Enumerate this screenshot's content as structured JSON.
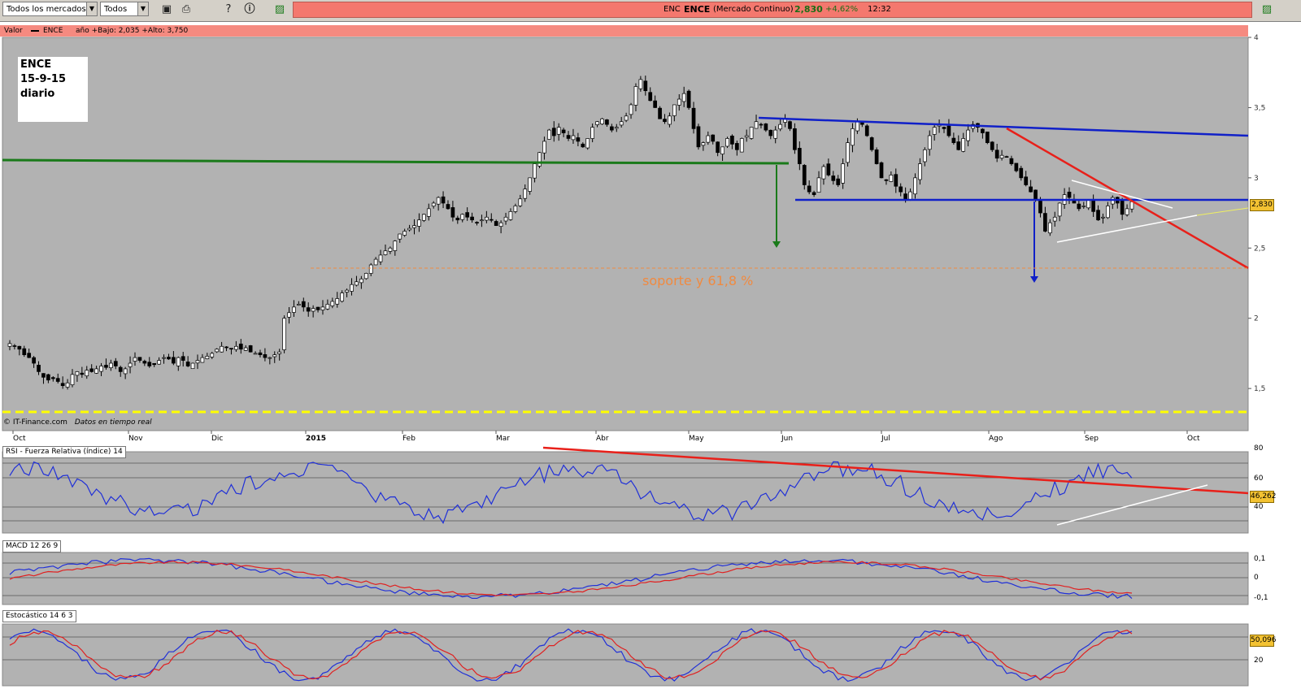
{
  "toolbar": {
    "market_select": "Todos los mercados",
    "type_select": "Todos",
    "ticker_code": "ENC",
    "ticker_name": "ENCE",
    "market": "(Mercado Continuo)",
    "price": "2,830",
    "change": "+4,62%",
    "time": "12:32"
  },
  "price_panel": {
    "header_label": "Valor",
    "header_symbol": "ENCE",
    "header_range": "año +Bajo: 2,035 +Alto: 3,750",
    "note_lines": [
      "ENCE",
      "15-9-15",
      "diario"
    ],
    "annotation": "soporte  y  61,8 %",
    "last_price_tag": "2,830",
    "source_label": "© IT-Finance.com",
    "source_note": "Datos en tiempo real"
  },
  "indicators": {
    "rsi": {
      "label": "RSI - Fuerza Relativa (índice) 14",
      "last_tag": "46,262",
      "ticks": [
        "80",
        "60",
        "40"
      ]
    },
    "macd": {
      "label": "MACD 12 26 9",
      "ticks": [
        "0,1",
        "0",
        "-0,1"
      ]
    },
    "stoch": {
      "label": "Estocástico 14 6 3",
      "last_tag": "50,096",
      "ticks": [
        "20"
      ]
    }
  },
  "chart_data": {
    "type": "candlestick",
    "title": "ENCE",
    "x_labels": [
      "Oct",
      "Nov",
      "Dic",
      "2015",
      "Feb",
      "Mar",
      "Abr",
      "May",
      "Jun",
      "Jul",
      "Ago",
      "Sep",
      "Oct"
    ],
    "y_ticks": [
      "4",
      "3,5",
      "3",
      "2,5",
      "2",
      "1,5"
    ],
    "ylim": [
      1.2,
      4.0
    ],
    "closes": [
      1.82,
      1.8,
      1.78,
      1.74,
      1.72,
      1.68,
      1.62,
      1.58,
      1.56,
      1.57,
      1.55,
      1.52,
      1.54,
      1.6,
      1.62,
      1.6,
      1.63,
      1.62,
      1.64,
      1.66,
      1.65,
      1.68,
      1.66,
      1.62,
      1.64,
      1.68,
      1.72,
      1.7,
      1.68,
      1.66,
      1.67,
      1.7,
      1.72,
      1.71,
      1.68,
      1.72,
      1.7,
      1.66,
      1.68,
      1.7,
      1.72,
      1.73,
      1.75,
      1.78,
      1.8,
      1.79,
      1.78,
      1.8,
      1.78,
      1.79,
      1.76,
      1.75,
      1.74,
      1.72,
      1.72,
      1.74,
      1.76,
      2.0,
      2.04,
      2.08,
      2.1,
      2.08,
      2.05,
      2.07,
      2.06,
      2.08,
      2.1,
      2.12,
      2.14,
      2.18,
      2.2,
      2.24,
      2.26,
      2.28,
      2.32,
      2.38,
      2.42,
      2.45,
      2.48,
      2.5,
      2.55,
      2.6,
      2.62,
      2.64,
      2.66,
      2.7,
      2.74,
      2.78,
      2.82,
      2.86,
      2.82,
      2.78,
      2.72,
      2.7,
      2.74,
      2.72,
      2.7,
      2.68,
      2.7,
      2.72,
      2.7,
      2.66,
      2.68,
      2.72,
      2.76,
      2.8,
      2.85,
      2.92,
      3.0,
      3.1,
      3.18,
      3.26,
      3.34,
      3.3,
      3.36,
      3.32,
      3.28,
      3.3,
      3.26,
      3.22,
      3.28,
      3.36,
      3.4,
      3.42,
      3.38,
      3.34,
      3.36,
      3.4,
      3.44,
      3.52,
      3.65,
      3.7,
      3.62,
      3.55,
      3.5,
      3.42,
      3.4,
      3.44,
      3.52,
      3.56,
      3.6,
      3.5,
      3.35,
      3.22,
      3.25,
      3.3,
      3.26,
      3.18,
      3.22,
      3.28,
      3.24,
      3.2,
      3.28,
      3.3,
      3.36,
      3.4,
      3.38,
      3.34,
      3.3,
      3.34,
      3.38,
      3.42,
      3.35,
      3.2,
      3.1,
      2.95,
      2.9,
      2.88,
      3.0,
      3.08,
      3.02,
      2.98,
      2.95,
      3.1,
      3.25,
      3.35,
      3.4,
      3.38,
      3.3,
      3.2,
      3.1,
      3.0,
      2.98,
      3.02,
      2.94,
      2.9,
      2.85,
      2.9,
      3.0,
      3.1,
      3.2,
      3.3,
      3.36,
      3.38,
      3.35,
      3.3,
      3.25,
      3.2,
      3.28,
      3.34,
      3.38,
      3.36,
      3.32,
      3.25,
      3.2,
      3.14,
      3.16,
      3.15,
      3.1,
      3.05,
      3.0,
      2.95,
      2.9,
      2.85,
      2.75,
      2.62,
      2.68,
      2.72,
      2.82,
      2.88,
      2.86,
      2.82,
      2.78,
      2.8,
      2.84,
      2.76,
      2.7,
      2.72,
      2.8,
      2.86,
      2.82,
      2.74,
      2.78,
      2.83
    ]
  }
}
